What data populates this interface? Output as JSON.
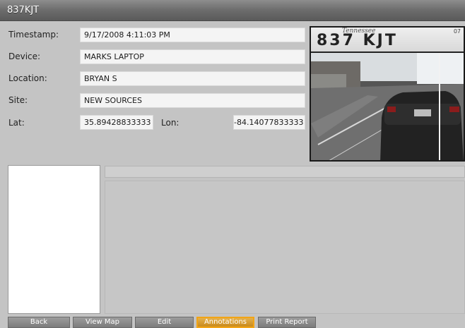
{
  "window": {
    "title": "837KJT"
  },
  "details": {
    "timestamp_label": "Timestamp:",
    "timestamp_value": "9/17/2008 4:11:03 PM",
    "device_label": "Device:",
    "device_value": "MARKS LAPTOP",
    "location_label": "Location:",
    "location_value": "BRYAN S",
    "site_label": "Site:",
    "site_value": "NEW SOURCES",
    "lat_label": "Lat:",
    "lat_value": "35.89428833333",
    "lon_label": "Lon:",
    "lon_value": "-84.14077833333"
  },
  "plate_image": {
    "plate_text": "837 KJT",
    "plate_state_script": "Tennessee",
    "plate_code": "07"
  },
  "buttons": {
    "back": "Back",
    "view_map": "View Map",
    "edit": "Edit",
    "annotations": "Annotations",
    "print_report": "Print Report"
  },
  "colors": {
    "active_button": "#f2a415",
    "title_bar": "#6c6c6c"
  }
}
